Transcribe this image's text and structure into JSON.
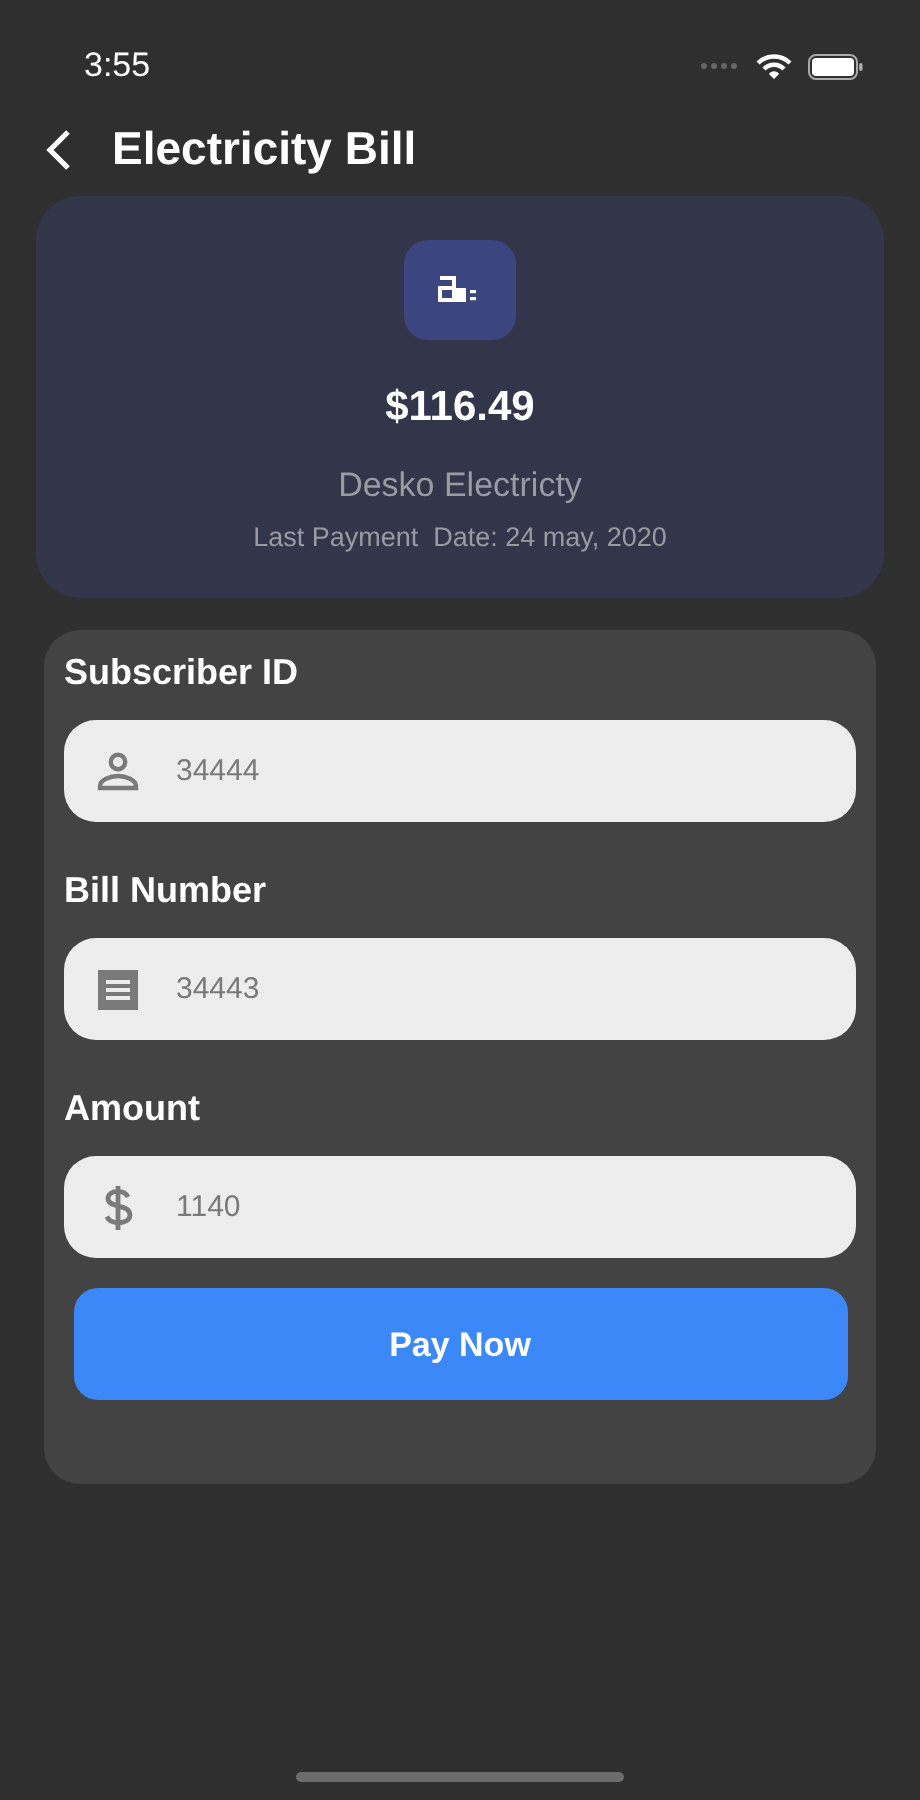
{
  "status_bar": {
    "time": "3:55"
  },
  "header": {
    "title": "Electricity Bill"
  },
  "bill": {
    "amount": "$116.49",
    "provider": "Desko Electricty",
    "last_payment": "Last Payment  Date: 24 may, 2020"
  },
  "fields": [
    {
      "label": "Subscriber ID",
      "kind": "person",
      "value": "34444"
    },
    {
      "label": "Bill Number",
      "kind": "receipt",
      "value": "34443"
    },
    {
      "label": "Amount",
      "kind": "dollar",
      "value": "1140"
    }
  ],
  "button": "Pay Now"
}
